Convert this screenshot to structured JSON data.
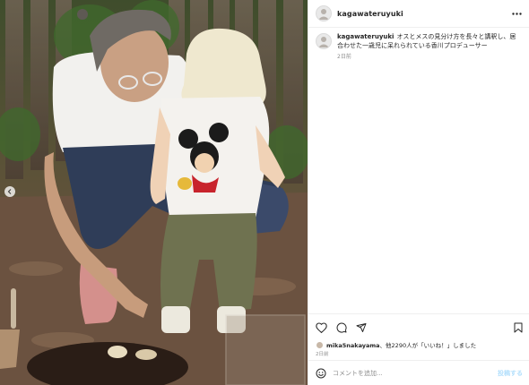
{
  "post": {
    "username": "kagawateruyuki",
    "avatar_icon": "profile-avatar-icon",
    "more_icon": "more-horizontal-icon",
    "photo_alt_icon": "carousel-prev-icon"
  },
  "caption": {
    "username": "kagawateruyuki",
    "text": "オスとメスの見分け方を長々と講釈し、居合わせた一歳児に呆れられている香川プロデューサー",
    "time": "2日前"
  },
  "actions": {
    "like_icon": "heart-icon",
    "comment_icon": "comment-icon",
    "share_icon": "share-icon",
    "save_icon": "bookmark-icon"
  },
  "likes": {
    "user": "mika5nakayama",
    "text": "、他2290人が「いいね！」しました"
  },
  "post_time": "2日前",
  "comment": {
    "placeholder": "コメントを追加...",
    "post_label": "投稿する",
    "emoji_icon": "emoji-icon"
  },
  "colors": {
    "text": "#262626",
    "muted": "#8e8e8e",
    "border": "#efefef",
    "post_button": "#b2dffc"
  }
}
